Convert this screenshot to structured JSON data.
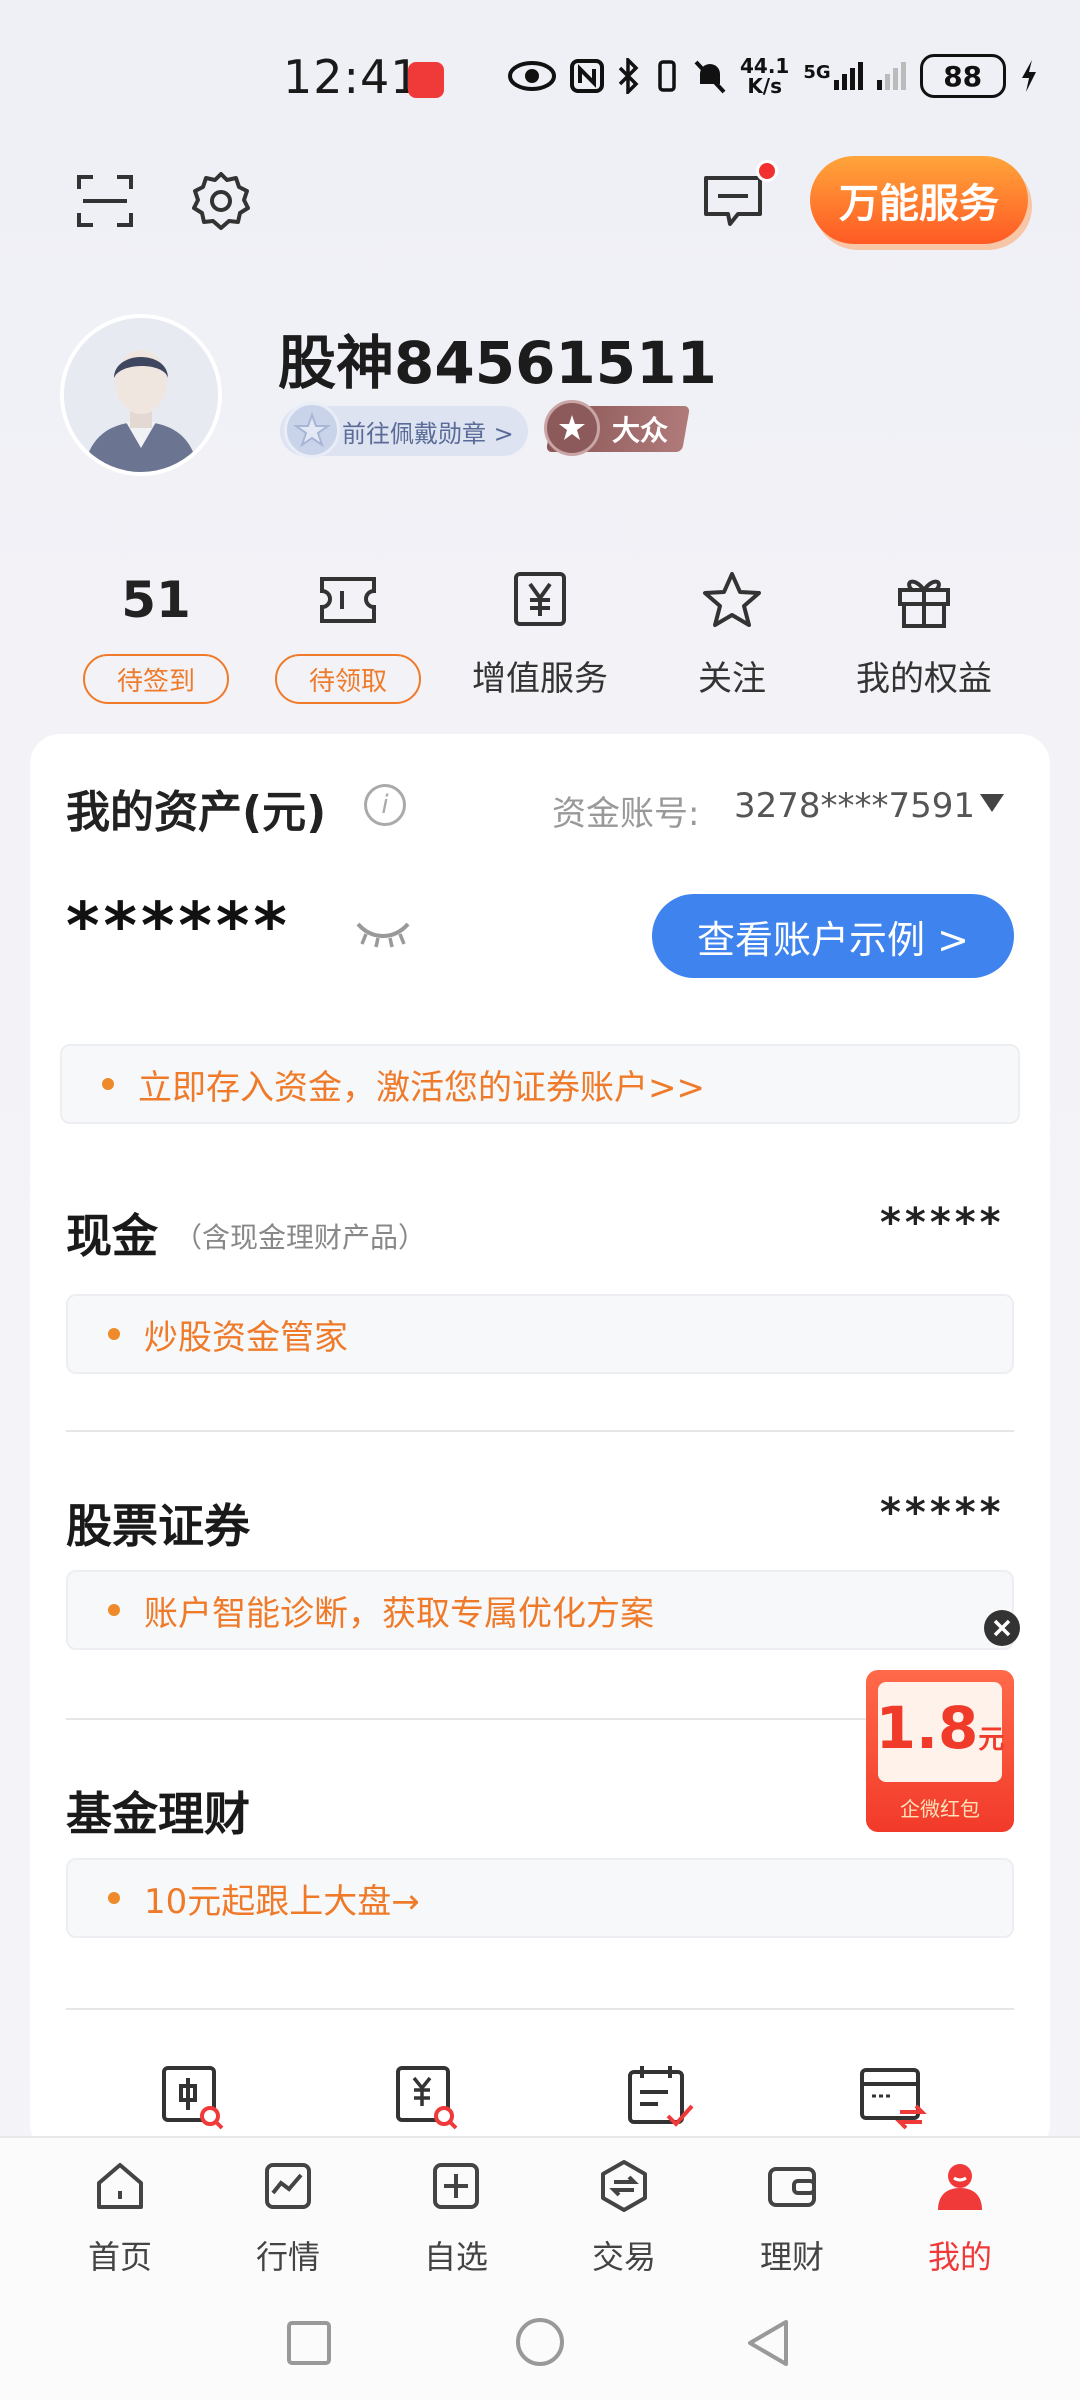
{
  "status_bar": {
    "time": "12:41",
    "net_speed_top": "44.1",
    "net_speed_bottom": "K/s",
    "network": "5G",
    "battery": "88"
  },
  "header": {
    "scan_icon": "scan-icon",
    "settings_icon": "gear-icon",
    "message_icon": "message-icon",
    "service_button": "万能服务"
  },
  "profile": {
    "username": "股神84561511",
    "medal_link": "前往佩戴勋章 >",
    "rank": "大众"
  },
  "quick_stats": [
    {
      "value": "51",
      "tag": "待签到"
    },
    {
      "icon": "coupon-icon",
      "tag": "待领取"
    },
    {
      "icon": "yen-document-icon",
      "label": "增值服务"
    },
    {
      "icon": "star-icon",
      "label": "关注"
    },
    {
      "icon": "gift-icon",
      "label": "我的权益"
    }
  ],
  "assets": {
    "title": "我的资产(元)",
    "account_label": "资金账号:",
    "account_no": "3278****7591",
    "total_masked": "******",
    "view_example_button": "查看账户示例 >",
    "activation_notice": "立即存入资金，激活您的证券账户>>"
  },
  "sections": {
    "cash": {
      "title": "现金",
      "subtitle": "（含现金理财产品）",
      "value": "*****",
      "notice": "炒股资金管家"
    },
    "stocks": {
      "title": "股票证券",
      "value": "*****",
      "notice": "账户智能诊断，获取专属优化方案"
    },
    "funds": {
      "title": "基金理财",
      "notice": "10元起跟上大盘→"
    }
  },
  "red_packet": {
    "amount": "1.8",
    "unit": "元",
    "label": "企微红包"
  },
  "tabbar": [
    {
      "label": "首页",
      "icon": "home-icon"
    },
    {
      "label": "行情",
      "icon": "chart-icon"
    },
    {
      "label": "自选",
      "icon": "plus-square-icon"
    },
    {
      "label": "交易",
      "icon": "exchange-icon"
    },
    {
      "label": "理财",
      "icon": "wallet-icon"
    },
    {
      "label": "我的",
      "icon": "user-icon",
      "active": true
    }
  ],
  "colors": {
    "accent_orange": "#ef7b2a",
    "accent_blue": "#3f84ee",
    "accent_red": "#f03a3a"
  }
}
